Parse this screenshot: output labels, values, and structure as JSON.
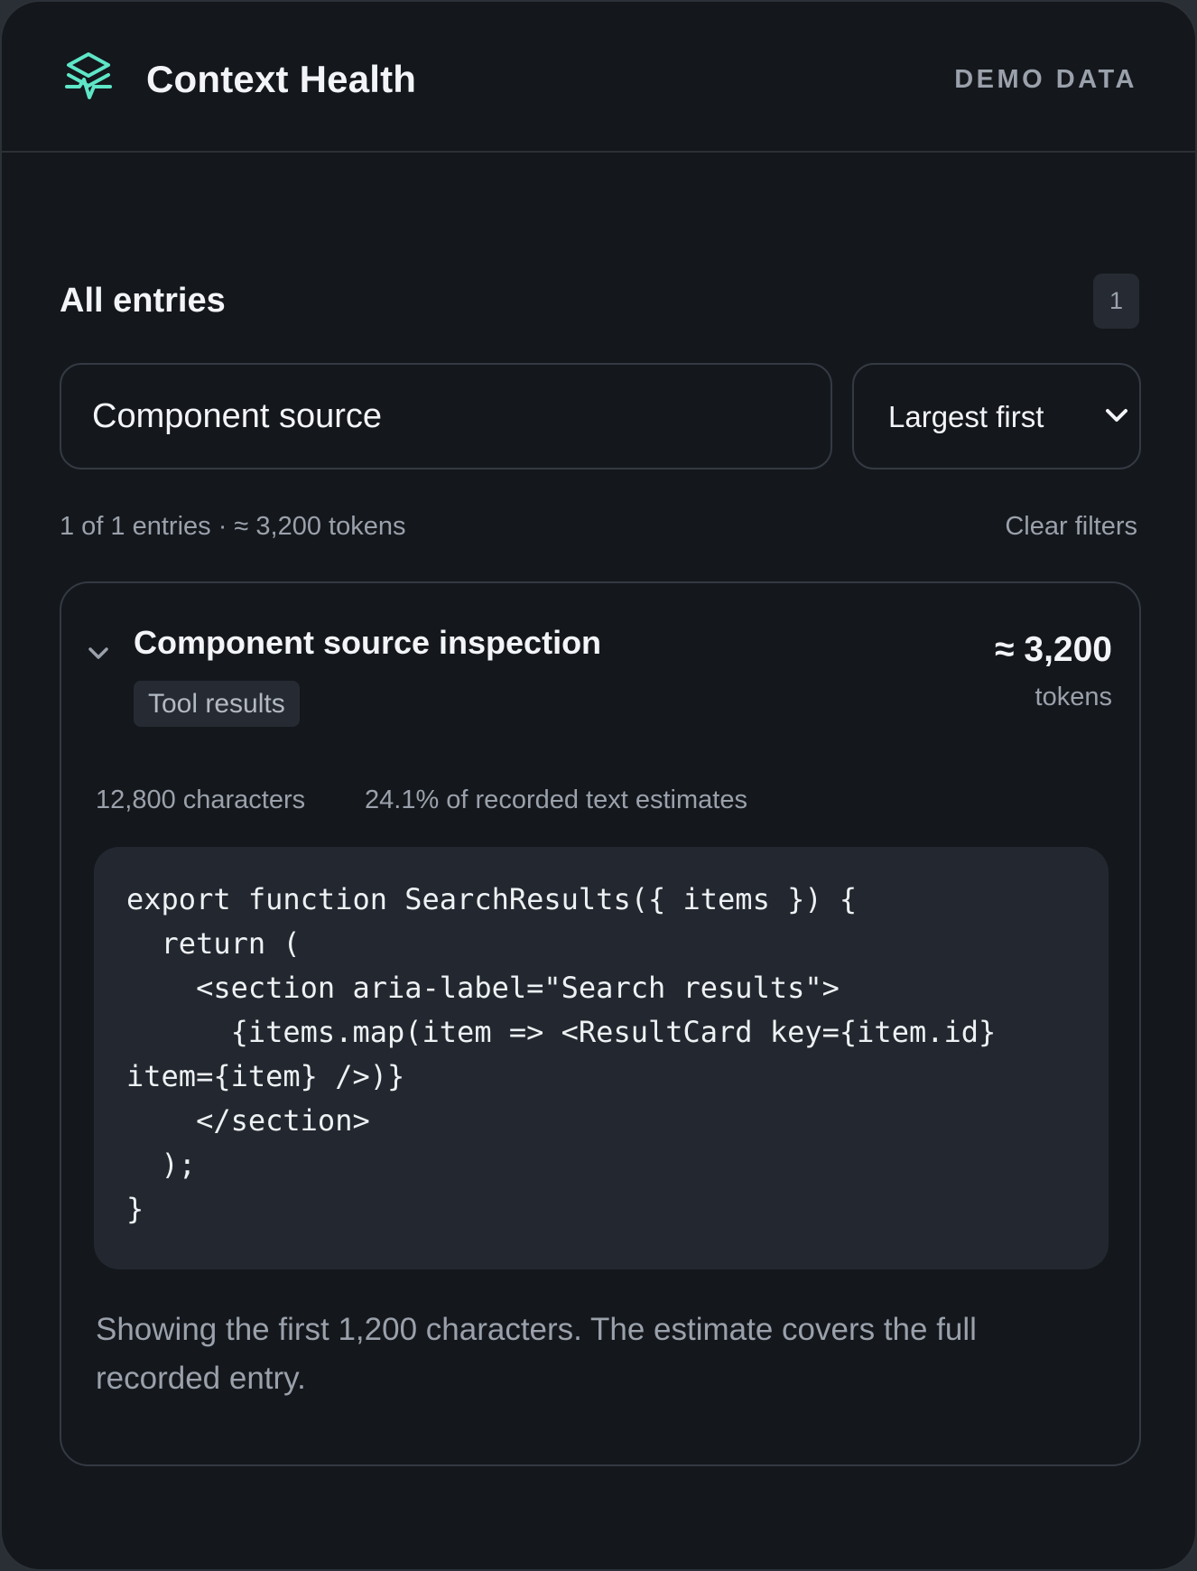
{
  "header": {
    "title": "Context Health",
    "badge": "DEMO DATA",
    "logo_icon": "layers-pulse-icon",
    "accent_color": "#5ee6c7"
  },
  "entries_section": {
    "title": "All entries",
    "count": "1",
    "search": {
      "value": "Component source",
      "placeholder": ""
    },
    "sort": {
      "selected": "Largest first"
    },
    "summary": "1 of 1 entries · ≈ 3,200 tokens",
    "clear_filters_label": "Clear filters"
  },
  "entry": {
    "title": "Component source inspection",
    "tag": "Tool results",
    "tokens_value": "≈ 3,200",
    "tokens_unit": "tokens",
    "characters": "12,800 characters",
    "share": "24.1% of recorded text estimates",
    "code": "export function SearchResults({ items }) {\n  return (\n    <section aria-label=\"Search results\">\n      {items.map(item => <ResultCard key={item.id} item={item} />)}\n    </section>\n  );\n}",
    "preview_note": "Showing the first 1,200 characters. The estimate covers the full recorded entry."
  }
}
